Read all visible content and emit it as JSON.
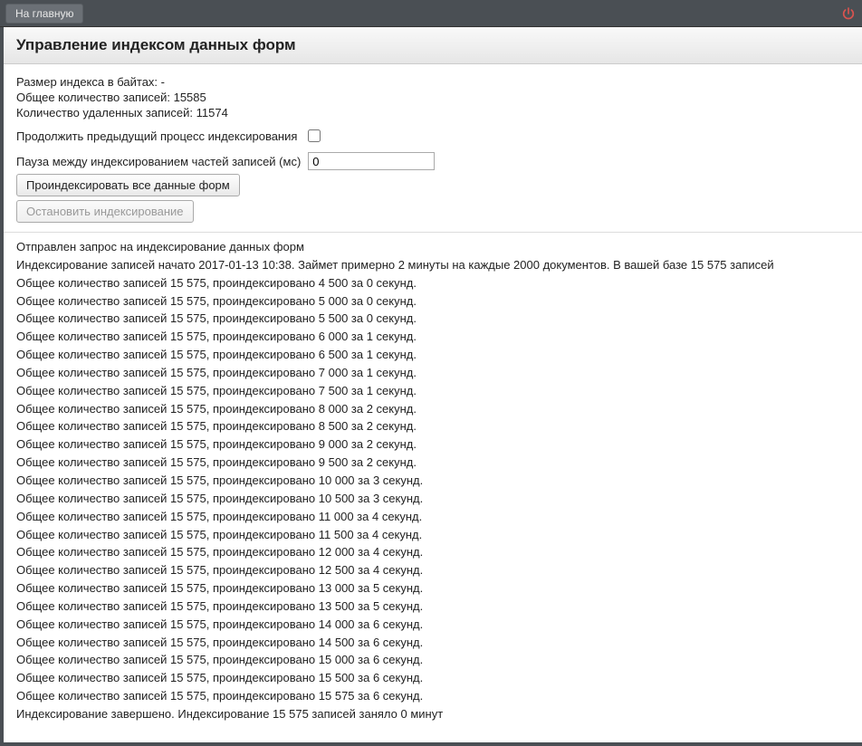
{
  "topbar": {
    "home_label": "На главную"
  },
  "header": {
    "title": "Управление индексом данных форм"
  },
  "stats": {
    "index_size_label": "Размер индекса в байтах:",
    "index_size_value": "-",
    "total_records_label": "Общее количество записей:",
    "total_records_value": "15585",
    "deleted_records_label": "Количество удаленных записей:",
    "deleted_records_value": "11574"
  },
  "form": {
    "continue_label": "Продолжить предыдущий процесс индексирования",
    "pause_label": "Пауза между индексированием частей записей (мс)",
    "pause_value": "0",
    "index_button": "Проиндексировать все данные форм",
    "stop_button": "Остановить индексирование"
  },
  "log": [
    "Отправлен запрос на индексирование данных форм",
    "Индексирование записей начато 2017-01-13 10:38. Займет примерно 2 минуты на каждые 2000 документов. В вашей базе 15 575 записей",
    "Общее количество записей 15 575, проиндексировано 4 500 за 0 секунд.",
    "Общее количество записей 15 575, проиндексировано 5 000 за 0 секунд.",
    "Общее количество записей 15 575, проиндексировано 5 500 за 0 секунд.",
    "Общее количество записей 15 575, проиндексировано 6 000 за 1 секунд.",
    "Общее количество записей 15 575, проиндексировано 6 500 за 1 секунд.",
    "Общее количество записей 15 575, проиндексировано 7 000 за 1 секунд.",
    "Общее количество записей 15 575, проиндексировано 7 500 за 1 секунд.",
    "Общее количество записей 15 575, проиндексировано 8 000 за 2 секунд.",
    "Общее количество записей 15 575, проиндексировано 8 500 за 2 секунд.",
    "Общее количество записей 15 575, проиндексировано 9 000 за 2 секунд.",
    "Общее количество записей 15 575, проиндексировано 9 500 за 2 секунд.",
    "Общее количество записей 15 575, проиндексировано 10 000 за 3 секунд.",
    "Общее количество записей 15 575, проиндексировано 10 500 за 3 секунд.",
    "Общее количество записей 15 575, проиндексировано 11 000 за 4 секунд.",
    "Общее количество записей 15 575, проиндексировано 11 500 за 4 секунд.",
    "Общее количество записей 15 575, проиндексировано 12 000 за 4 секунд.",
    "Общее количество записей 15 575, проиндексировано 12 500 за 4 секунд.",
    "Общее количество записей 15 575, проиндексировано 13 000 за 5 секунд.",
    "Общее количество записей 15 575, проиндексировано 13 500 за 5 секунд.",
    "Общее количество записей 15 575, проиндексировано 14 000 за 6 секунд.",
    "Общее количество записей 15 575, проиндексировано 14 500 за 6 секунд.",
    "Общее количество записей 15 575, проиндексировано 15 000 за 6 секунд.",
    "Общее количество записей 15 575, проиндексировано 15 500 за 6 секунд.",
    "Общее количество записей 15 575, проиндексировано 15 575 за 6 секунд.",
    "Индексирование завершено. Индексирование 15 575 записей заняло 0 минут"
  ]
}
